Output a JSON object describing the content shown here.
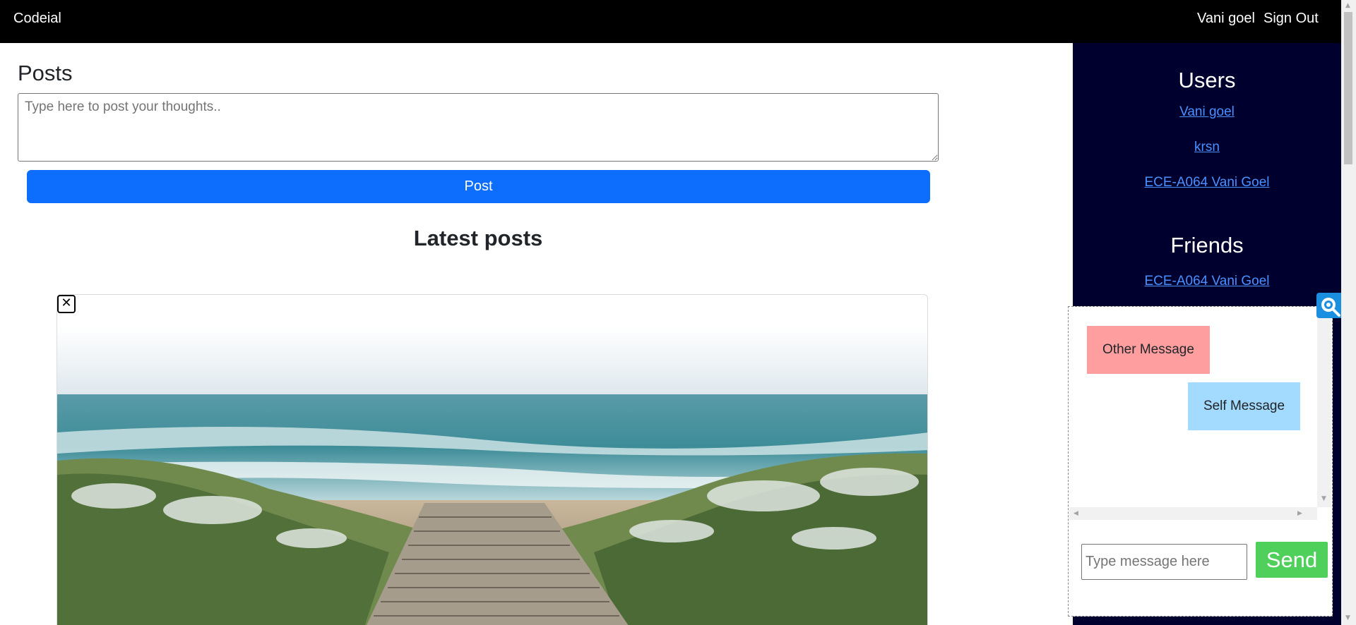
{
  "navbar": {
    "brand": "Codeial",
    "user_name": "Vani goel",
    "sign_out": "Sign Out",
    "background": "#000000"
  },
  "posts": {
    "heading": "Posts",
    "textarea_placeholder": "Type here to post your thoughts..",
    "post_button": "Post",
    "latest_heading": "Latest posts",
    "post_button_color": "#0d6efd"
  },
  "post_card": {
    "delete_icon": "close-icon",
    "delete_glyph": "✕",
    "image": "beach-boardwalk-photo"
  },
  "sidebar": {
    "background": "#00002e",
    "users_heading": "Users",
    "users": [
      "Vani goel",
      "krsn",
      "ECE-A064 Vani Goel"
    ],
    "friends_heading": "Friends",
    "friends": [
      "ECE-A064 Vani Goel"
    ]
  },
  "chat": {
    "messages": [
      {
        "type": "other",
        "text": "Other Message",
        "color": "#ff9e9e"
      },
      {
        "type": "self",
        "text": "Self Message",
        "color": "#a3daff"
      }
    ],
    "input_placeholder": "Type message here",
    "send_button": "Send",
    "send_color": "#4fd05b",
    "zoom_icon": "zoom-icon"
  }
}
